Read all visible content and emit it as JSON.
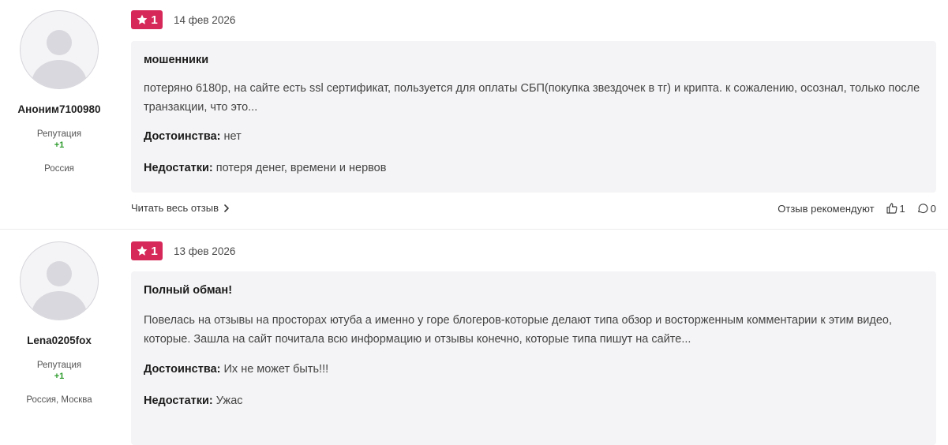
{
  "reviews": [
    {
      "author": {
        "name": "Аноним7100980",
        "rep_label": "Репутация",
        "rep_value": "+1",
        "location": "Россия"
      },
      "rating": "1",
      "date": "14 фев 2026",
      "title": "мошенники",
      "text": "потеряно 6180р, на сайте есть ssl сертификат, пользуется для оплаты СБП(покупка звездочек в тг) и крипта. к сожалению, осознал, только после транзакции, что это...",
      "pros_label": "Достоинства:",
      "pros": "нет",
      "cons_label": "Недостатки:",
      "cons": "потеря денег, времени и нервов",
      "read_more": "Читать весь отзыв",
      "recommend_label": "Отзыв рекомендуют",
      "likes": "1",
      "comments": "0"
    },
    {
      "author": {
        "name": "Lena0205fox",
        "rep_label": "Репутация",
        "rep_value": "+1",
        "location": "Россия, Москва"
      },
      "rating": "1",
      "date": "13 фев 2026",
      "title": "Полный обман!",
      "text": "Повелась на отзывы на просторах ютуба а именно у горе блогеров-которые делают типа обзор и восторженным комментарии к этим видео, которые. Зашла на сайт почитала всю информацию и отзывы конечно, которые типа пишут на сайте...",
      "pros_label": "Достоинства:",
      "pros": "Их не может быть!!!",
      "cons_label": "Недостатки:",
      "cons": "Ужас"
    }
  ],
  "colors": {
    "badge": "#d6295a",
    "panel": "#f4f4f6",
    "reputation": "#2b9a2b"
  },
  "icons": [
    "star-icon",
    "chevron-right-icon",
    "thumbs-up-icon",
    "comment-icon",
    "avatar-placeholder"
  ]
}
